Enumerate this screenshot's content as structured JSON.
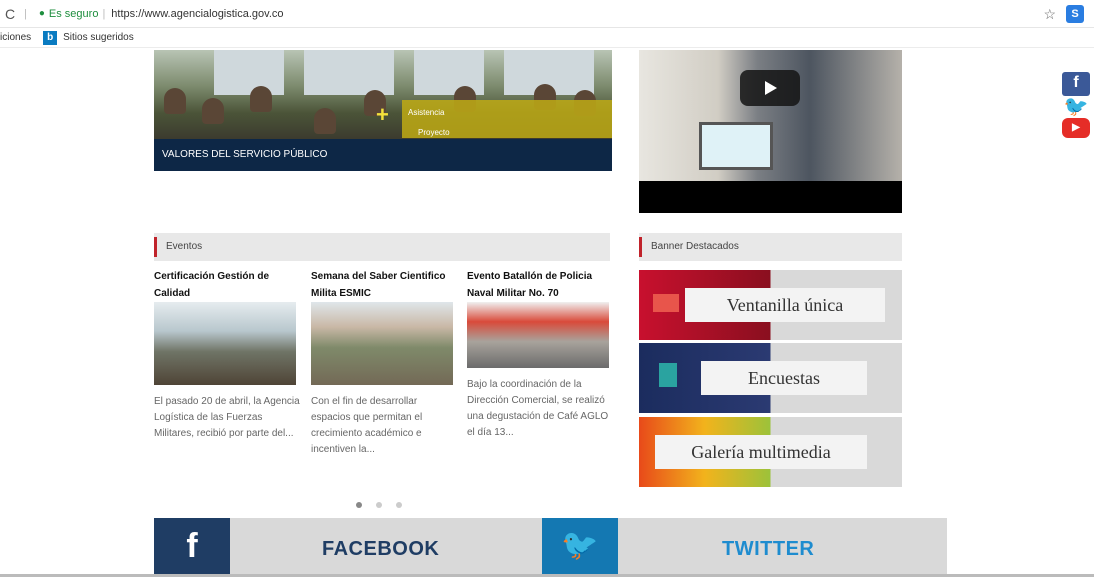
{
  "browser": {
    "secure_label": "Es seguro",
    "url": "https://www.agencialogistica.gov.co",
    "bookmarks": {
      "partial_label": "iciones",
      "suggested_label": "Sitios sugeridos",
      "bing_glyph": "b"
    },
    "extension_glyph": "S"
  },
  "hero": {
    "caption": "VALORES DEL SERVICIO PÚBLICO",
    "overlay_line1": "Asistencia",
    "overlay_line2": "Proyecto"
  },
  "social_side": {
    "fb_glyph": "f",
    "tw_glyph": "🐦",
    "yt_glyph": "▶"
  },
  "events": {
    "header": "Eventos",
    "items": [
      {
        "title": "Certificación Gestión de Calidad",
        "desc": "El pasado 20 de abril, la Agencia Logística de las Fuerzas Militares, recibió por parte del..."
      },
      {
        "title": "Semana del Saber Cientifico Milita ESMIC",
        "desc": "Con el fin de desarrollar espacios que permitan el crecimiento académico e incentiven la..."
      },
      {
        "title": "Evento Batallón de Policia Naval Militar No. 70",
        "desc": "Bajo la coordinación de la Dirección Comercial, se realizó una degustación de Café AGLO el día 13..."
      }
    ],
    "carousel_active_index": 0
  },
  "banners": {
    "header": "Banner Destacados",
    "items": [
      {
        "label": "Ventanilla única"
      },
      {
        "label": "Encuestas"
      },
      {
        "label": "Galería multimedia"
      }
    ]
  },
  "footer_social": {
    "facebook_label": "FACEBOOK",
    "twitter_label": "TWITTER",
    "fb_glyph": "f",
    "tw_glyph": "🐦"
  },
  "colors": {
    "navy": "#0d2746",
    "accent_red": "#c0232b",
    "facebook_blue": "#1f3d64",
    "twitter_blue": "#1e8ccf",
    "overlay_yellow": "#beaa14"
  }
}
